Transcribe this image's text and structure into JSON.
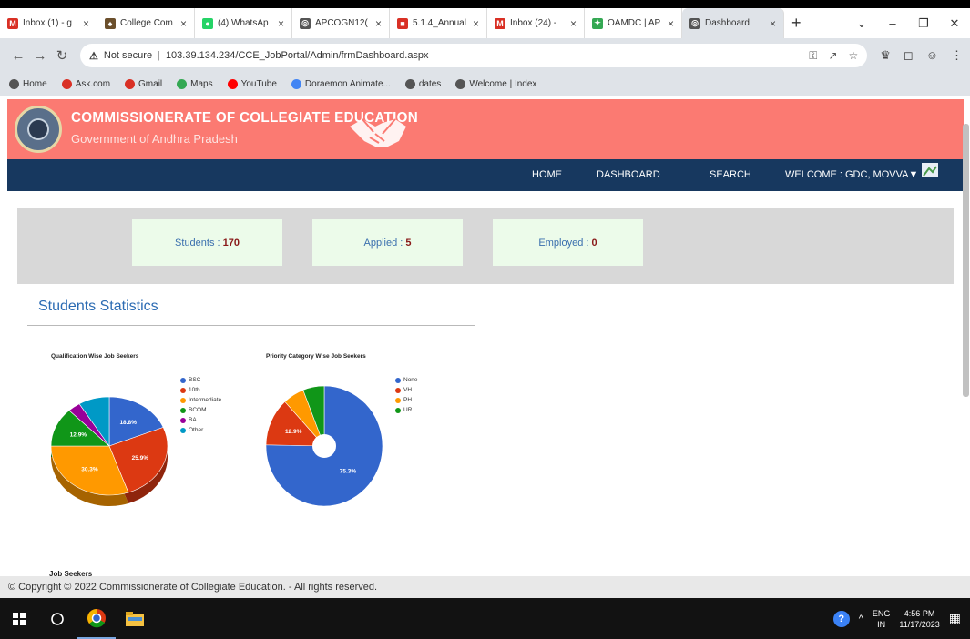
{
  "browser": {
    "tabs": [
      {
        "label": "Inbox (1) - g",
        "icon": "gmail-icon",
        "color": "#d93025",
        "glyph": "M"
      },
      {
        "label": "College Com",
        "icon": "college-icon",
        "color": "#6b4f2c",
        "glyph": "♠"
      },
      {
        "label": "(4) WhatsAp",
        "icon": "whatsapp-icon",
        "color": "#25d366",
        "glyph": "●"
      },
      {
        "label": "APCOGN12(",
        "icon": "globe-icon",
        "color": "#555555",
        "glyph": "◎"
      },
      {
        "label": "5.1.4_Annual",
        "icon": "sheet-icon",
        "color": "#d93025",
        "glyph": "■"
      },
      {
        "label": "Inbox (24) - ",
        "icon": "gmail-icon",
        "color": "#d93025",
        "glyph": "M"
      },
      {
        "label": "OAMDC | AP",
        "icon": "oamdc-icon",
        "color": "#34a853",
        "glyph": "✦"
      },
      {
        "label": "Dashboard",
        "icon": "globe-icon",
        "color": "#555555",
        "glyph": "◎",
        "active": true
      }
    ],
    "url_warning": "Not secure",
    "url": "103.39.134.234/CCE_JobPortal/Admin/frmDashboard.aspx",
    "bookmarks": [
      {
        "label": "Home",
        "color": "#555555"
      },
      {
        "label": "Ask.com",
        "color": "#d93025"
      },
      {
        "label": "Gmail",
        "color": "#d93025"
      },
      {
        "label": "Maps",
        "color": "#34a853"
      },
      {
        "label": "YouTube",
        "color": "#ff0000"
      },
      {
        "label": "Doraemon Animate...",
        "color": "#4285f4"
      },
      {
        "label": "dates",
        "color": "#555555"
      },
      {
        "label": "Welcome | Index",
        "color": "#555555"
      }
    ]
  },
  "header": {
    "title": "COMMISSIONERATE OF COLLEGIATE EDUCATION",
    "subtitle": "Government of Andhra Pradesh"
  },
  "nav": {
    "home": "HOME",
    "dashboard": "DASHBOARD",
    "search": "SEARCH",
    "welcome": "WELCOME : GDC, MOVVA▼"
  },
  "stats": [
    {
      "label": "Students :",
      "value": "170"
    },
    {
      "label": "Applied :",
      "value": "5"
    },
    {
      "label": "Employed :",
      "value": "0"
    }
  ],
  "section_title": "Students Statistics",
  "job_seekers_label": "Job Seekers",
  "footer": "© Copyright © 2022 Commissionerate of Collegiate Education. - All rights reserved.",
  "taskbar": {
    "lang": "ENG",
    "region": "IN",
    "time": "4:56 PM",
    "date": "11/17/2023"
  },
  "chart_data": [
    {
      "type": "pie",
      "title": "Qualification Wise Job Seekers",
      "categories": [
        "BSC",
        "10th",
        "Intermediate",
        "BCOM",
        "BA",
        "Other"
      ],
      "values": [
        18.8,
        25.9,
        30.3,
        12.9,
        3.5,
        8.6
      ],
      "data_labels": [
        "18.8%",
        "25.9%",
        "30.3%",
        "12.9%",
        "",
        ""
      ],
      "colors": [
        "#3366cc",
        "#dc3912",
        "#ff9900",
        "#109618",
        "#990099",
        "#0099c6"
      ],
      "legend": "right",
      "style": "3d"
    },
    {
      "type": "pie",
      "title": "Priority Category Wise Job Seekers",
      "categories": [
        "None",
        "VH",
        "PH",
        "UR"
      ],
      "values": [
        75.3,
        12.9,
        5.9,
        5.9
      ],
      "data_labels": [
        "75.3%",
        "12.9%",
        "",
        ""
      ],
      "colors": [
        "#3366cc",
        "#dc3912",
        "#ff9900",
        "#109618"
      ],
      "legend": "right",
      "style": "donut"
    }
  ]
}
